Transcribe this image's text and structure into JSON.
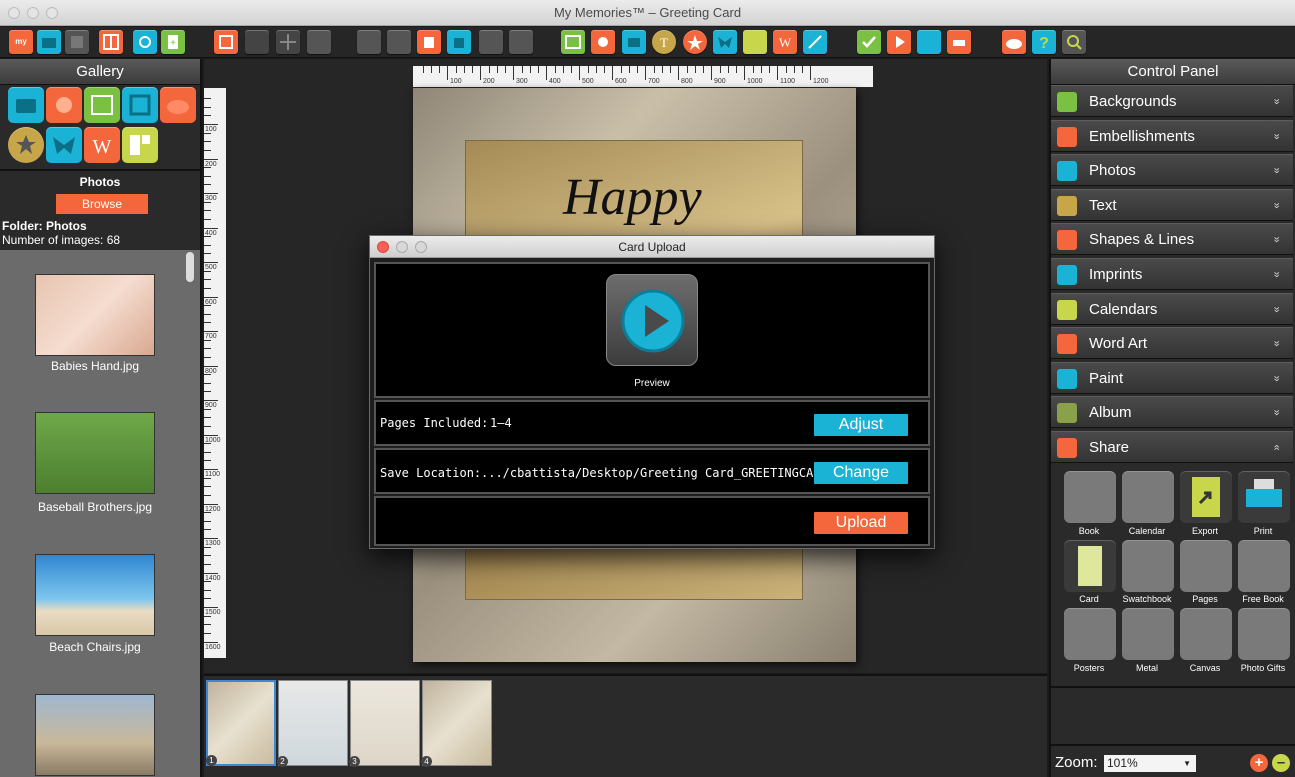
{
  "window": {
    "title": "My Memories™ – Greeting Card"
  },
  "colors": {
    "accent_orange": "#f4663c",
    "accent_cyan": "#1ab3d6",
    "panel_dark": "#2a2a2a"
  },
  "toolbar": {
    "icons": [
      "mymemories-logo-icon",
      "folder-icon",
      "save-icon",
      "layout-icon",
      "camera-icon",
      "add-page-icon",
      "duplicate-icon",
      "grid-icon",
      "crosshair-icon",
      "align-icon",
      "cut-icon",
      "copy-icon",
      "paste-icon",
      "fill-icon",
      "crop-icon",
      "rotate-icon",
      "background-icon",
      "embellishment-icon",
      "photo-icon",
      "text-icon",
      "shape-icon",
      "imprint-icon",
      "calendar-icon",
      "word-art-icon",
      "paint-icon",
      "check-icon",
      "play-icon",
      "export-icon",
      "print-icon",
      "cloud-icon",
      "help-icon",
      "zoom-icon"
    ]
  },
  "gallery": {
    "header": "Gallery",
    "section_title": "Photos",
    "browse_label": "Browse",
    "folder": "Folder: Photos",
    "count": "Number of images: 68",
    "items": [
      {
        "caption": "Babies Hand.jpg"
      },
      {
        "caption": "Baseball Brothers.jpg"
      },
      {
        "caption": "Beach Chairs.jpg"
      },
      {
        "caption": ""
      }
    ]
  },
  "ruler": {
    "h_labels": [
      "100",
      "200",
      "300",
      "400",
      "500",
      "600",
      "700",
      "800",
      "900",
      "1000",
      "1100",
      "1200"
    ],
    "v_labels": [
      "100",
      "200",
      "300",
      "400",
      "500",
      "600",
      "700",
      "800",
      "900",
      "1000",
      "1100",
      "1200",
      "1300",
      "1400",
      "1500",
      "1600"
    ]
  },
  "card": {
    "text": "Happy"
  },
  "filmstrip": {
    "pages": [
      "1",
      "2",
      "3",
      "4"
    ]
  },
  "control": {
    "header": "Control Panel",
    "rows": [
      {
        "label": "Backgrounds",
        "chev": "»"
      },
      {
        "label": "Embellishments",
        "chev": "»"
      },
      {
        "label": "Photos",
        "chev": "»"
      },
      {
        "label": "Text",
        "chev": "»"
      },
      {
        "label": "Shapes & Lines",
        "chev": "»"
      },
      {
        "label": "Imprints",
        "chev": "»"
      },
      {
        "label": "Calendars",
        "chev": "»"
      },
      {
        "label": "Word Art",
        "chev": "»"
      },
      {
        "label": "Paint",
        "chev": "»"
      },
      {
        "label": "Album",
        "chev": "»"
      },
      {
        "label": "Share",
        "chev": "«"
      }
    ],
    "share_items": [
      "Book",
      "Calendar",
      "Export",
      "Print",
      "Card",
      "Swatchbook",
      "Pages",
      "Free Book",
      "Posters",
      "Metal",
      "Canvas",
      "Photo Gifts"
    ],
    "zoom_label": "Zoom:",
    "zoom_value": "101%"
  },
  "modal": {
    "title": "Card Upload",
    "preview_label": "Preview",
    "pages_label": "Pages Included:",
    "pages_value": "1–4",
    "adjust_label": "Adjust",
    "save_label": "Save Location:",
    "save_value": ".../cbattista/Desktop/Greeting Card_GREETINGCARD",
    "change_label": "Change",
    "upload_label": "Upload"
  }
}
